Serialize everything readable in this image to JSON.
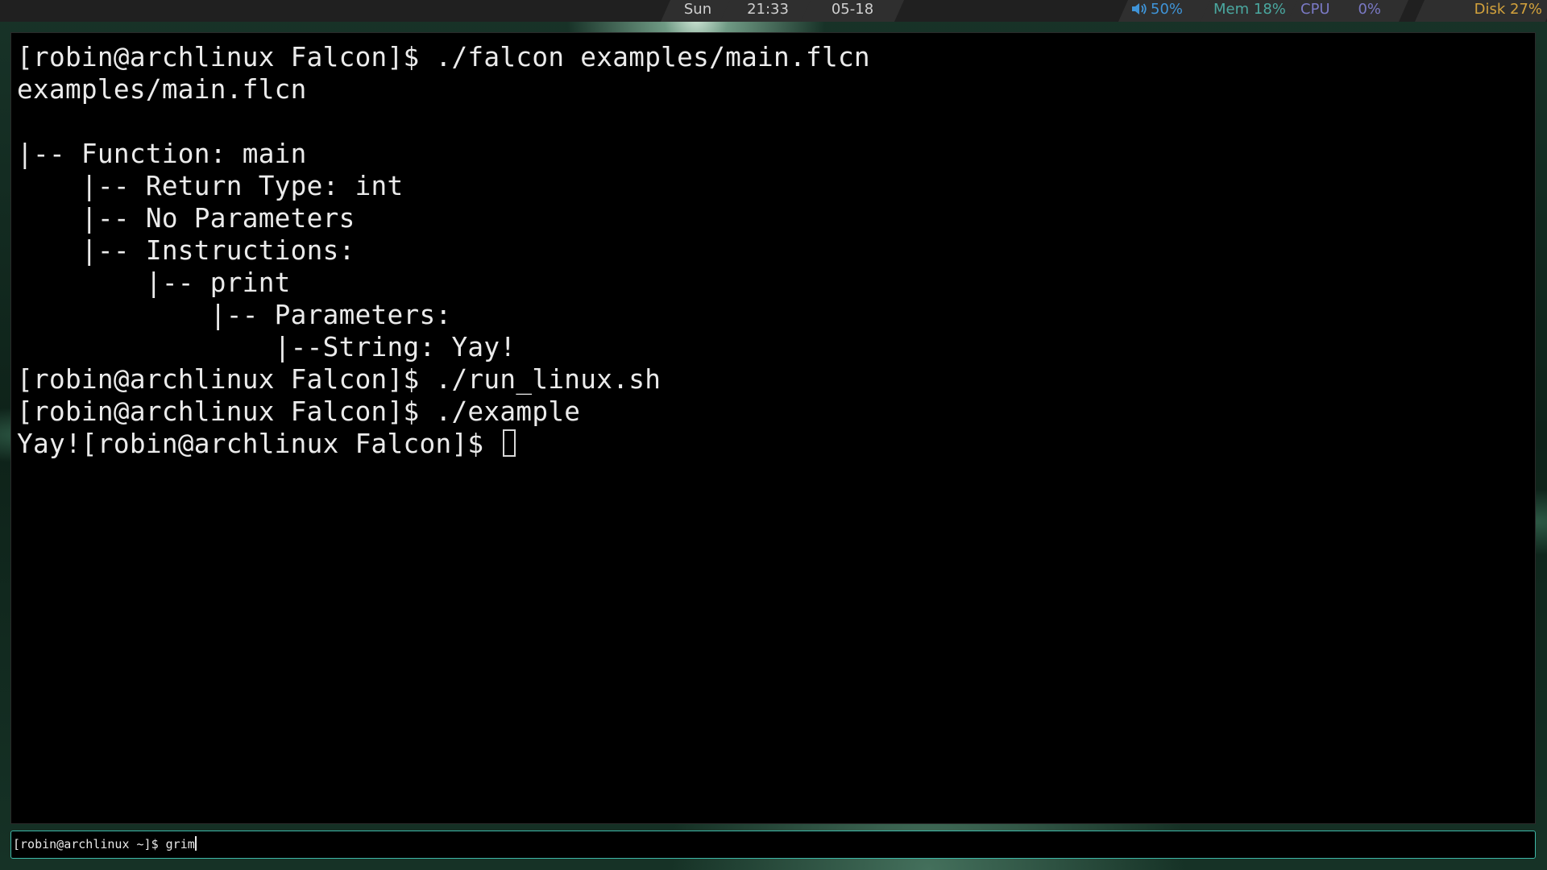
{
  "topbar": {
    "day": "Sun",
    "time": "21:33",
    "date": "05-18",
    "volume": {
      "icon": "speaker-icon",
      "value": "50%",
      "color": "#3f94d8"
    },
    "mem": {
      "label": "Mem",
      "value": "18%",
      "color": "#4aa8a0"
    },
    "cpu": {
      "label": "CPU",
      "value": "0%",
      "color": "#7a79c4"
    },
    "disk": {
      "label": "Disk",
      "value": "27%",
      "color": "#d3a23c"
    }
  },
  "terminal": {
    "lines": [
      "[robin@archlinux Falcon]$ ./falcon examples/main.flcn",
      "examples/main.flcn",
      "",
      "|-- Function: main",
      "    |-- Return Type: int",
      "    |-- No Parameters",
      "    |-- Instructions:",
      "        |-- print",
      "            |-- Parameters:",
      "                |--String: Yay!",
      "[robin@archlinux Falcon]$ ./run_linux.sh",
      "[robin@archlinux Falcon]$ ./example",
      "Yay![robin@archlinux Falcon]$ "
    ]
  },
  "prompt_bar": {
    "prompt": "[robin@archlinux ~]$ ",
    "input": "grim"
  }
}
